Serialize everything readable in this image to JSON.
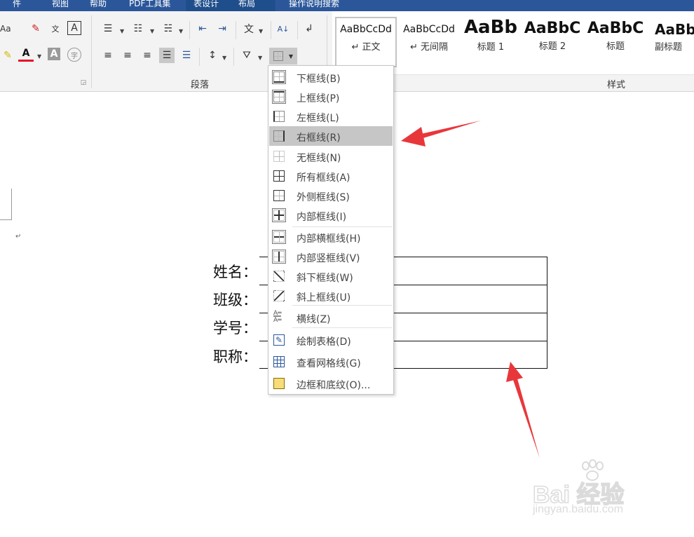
{
  "title_tabs": [
    "件",
    "视图",
    "帮助",
    "PDF工具集",
    "表设计",
    "布局",
    "操作说明搜索"
  ],
  "ribbon": {
    "paragraph_group_label": "段落",
    "styles_group_label": "样式",
    "font_row_aa": "Aa",
    "sort_icon": "sort-az-icon",
    "styles": [
      {
        "sample": "AaBbCcDd",
        "name": "↵ 正文",
        "selected": true
      },
      {
        "sample": "AaBbCcDd",
        "name": "↵ 无间隔"
      },
      {
        "sample": "AaBb",
        "name": "标题 1"
      },
      {
        "sample": "AaBbC",
        "name": "标题 2"
      },
      {
        "sample": "AaBbC",
        "name": "标题"
      },
      {
        "sample": "AaBb",
        "name": "副标题"
      }
    ]
  },
  "document": {
    "labels": [
      "姓名：",
      "班级：",
      "学号：",
      "职称："
    ],
    "para_mark": "↵"
  },
  "border_menu": {
    "items": [
      {
        "label": "下框线(B)",
        "icon": "bottom-border-icon"
      },
      {
        "label": "上框线(P)",
        "icon": "top-border-icon"
      },
      {
        "label": "左框线(L)",
        "icon": "left-border-icon"
      },
      {
        "label": "右框线(R)",
        "icon": "right-border-icon",
        "highlighted": true
      },
      {
        "label": "无框线(N)",
        "icon": "no-border-icon"
      },
      {
        "label": "所有框线(A)",
        "icon": "all-borders-icon"
      },
      {
        "label": "外侧框线(S)",
        "icon": "outside-borders-icon"
      },
      {
        "label": "内部框线(I)",
        "icon": "inside-borders-icon"
      },
      {
        "label": "内部横框线(H)",
        "icon": "inside-horizontal-border-icon"
      },
      {
        "label": "内部竖框线(V)",
        "icon": "inside-vertical-border-icon"
      },
      {
        "label": "斜下框线(W)",
        "icon": "diagonal-down-border-icon"
      },
      {
        "label": "斜上框线(U)",
        "icon": "diagonal-up-border-icon"
      },
      {
        "label": "横线(Z)",
        "icon": "horizontal-line-icon"
      },
      {
        "label": "绘制表格(D)",
        "icon": "draw-table-icon"
      },
      {
        "label": "查看网格线(G)",
        "icon": "view-gridlines-icon"
      },
      {
        "label": "边框和底纹(O)...",
        "icon": "borders-shading-icon"
      }
    ]
  },
  "colors": {
    "accent": "#2b579a",
    "highlight": "#c6c6c6",
    "arrow": "#e8373b"
  },
  "watermark": {
    "brand": "Bai 经验",
    "url": "jingyan.baidu.com"
  }
}
